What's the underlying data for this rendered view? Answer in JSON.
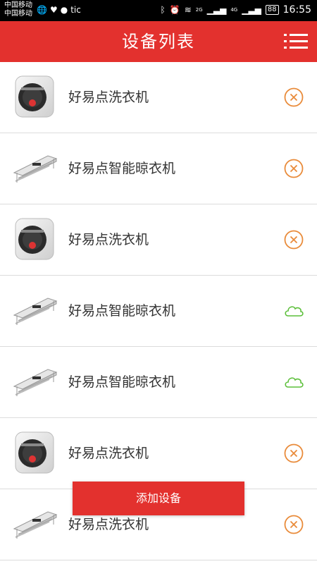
{
  "status_bar": {
    "carrier_1": "中国移动",
    "carrier_2": "中国移动",
    "app_text": "tic",
    "network_2g": "2G",
    "network_4g": "4G",
    "battery": "88",
    "time": "16:55"
  },
  "header": {
    "title": "设备列表"
  },
  "devices": [
    {
      "name": "好易点洗衣机",
      "type": "washer",
      "status": "offline"
    },
    {
      "name": "好易点智能晾衣机",
      "type": "dryer-rack",
      "status": "offline"
    },
    {
      "name": "好易点洗衣机",
      "type": "washer",
      "status": "offline"
    },
    {
      "name": "好易点智能晾衣机",
      "type": "dryer-rack",
      "status": "online"
    },
    {
      "name": "好易点智能晾衣机",
      "type": "dryer-rack",
      "status": "online"
    },
    {
      "name": "好易点洗衣机",
      "type": "washer",
      "status": "offline"
    },
    {
      "name": "好易点洗衣机",
      "type": "dryer-rack",
      "status": "offline"
    }
  ],
  "add_device_label": "添加设备",
  "colors": {
    "brand_red": "#e3312e",
    "offline_orange": "#e98b3a",
    "online_green": "#5cbf3a"
  }
}
